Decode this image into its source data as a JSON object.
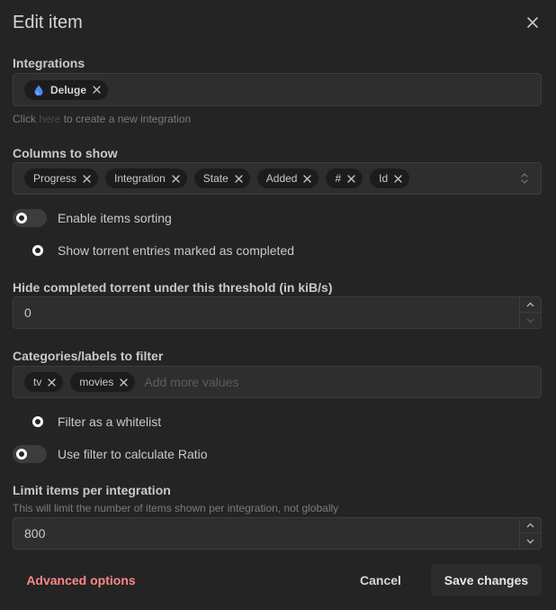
{
  "dialog": {
    "title": "Edit item"
  },
  "integrations": {
    "label": "Integrations",
    "selected": [
      "Deluge"
    ],
    "hint_prefix": "Click",
    "hint_link": "here",
    "hint_suffix": "to create a new integration"
  },
  "columns": {
    "label": "Columns to show",
    "values": [
      "Progress",
      "Integration",
      "State",
      "Added",
      "#",
      "Id"
    ]
  },
  "toggles": {
    "sorting": {
      "label": "Enable items sorting",
      "on": false
    },
    "show_completed": {
      "label": "Show torrent entries marked as completed",
      "on": true
    }
  },
  "threshold": {
    "label": "Hide completed torrent under this threshold (in kiB/s)",
    "value": "0"
  },
  "categories": {
    "label": "Categories/labels to filter",
    "values": [
      "tv",
      "movies"
    ],
    "placeholder": "Add more values"
  },
  "filter_toggles": {
    "whitelist": {
      "label": "Filter as a whitelist",
      "on": true
    },
    "ratio": {
      "label": "Use filter to calculate Ratio",
      "on": false
    }
  },
  "limit": {
    "label": "Limit items per integration",
    "description": "This will limit the number of items shown per integration, not globally",
    "value": "800"
  },
  "footer": {
    "advanced_label": "Advanced options",
    "cancel_label": "Cancel",
    "save_label": "Save changes"
  },
  "colors": {
    "background": "#242424",
    "field": "#2e2e2e",
    "pill": "#1c1c1c",
    "danger": "#ff8787",
    "deluge_blue": "#4c8bf5"
  }
}
